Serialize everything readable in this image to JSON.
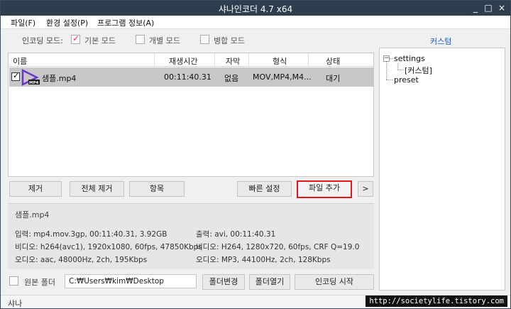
{
  "window": {
    "title": "샤나인코더 4.7 x64",
    "minimize": "_",
    "maximize": "□",
    "close": "×"
  },
  "menu": {
    "file": "파일(F)",
    "settings": "환경 설정(P)",
    "about": "프로그램 정보(A)"
  },
  "mode": {
    "label": "인코딩 모드:",
    "basic": "기본 모드",
    "individual": "개별 모드",
    "merge": "병합 모드",
    "basic_checked": true,
    "custom_link": "커스텀"
  },
  "filelist": {
    "columns": [
      "이름",
      "재생시간",
      "자막",
      "형식",
      "상태"
    ],
    "rows": [
      {
        "name": "샘플.mp4",
        "duration": "00:11:40.31",
        "subtitle": "없음",
        "format": "MOV,MP4,M4...",
        "status": "대기",
        "checked": true
      }
    ]
  },
  "tree": {
    "root": "settings",
    "child": "[커스텀]",
    "preset": "preset",
    "expander": "−"
  },
  "buttons": {
    "remove": "제거",
    "remove_all": "전체 제거",
    "items": "항목",
    "quick_settings": "빠른 설정",
    "add_file": "파일 추가",
    "more": ">",
    "change_folder": "폴더변경",
    "open_folder": "폴더열기",
    "start_encoding": "인코딩 시작"
  },
  "info": {
    "filename": "샘플.mp4",
    "input_line": "입력: mp4.mov.3gp, 00:11:40.31, 3.92GB",
    "input_video": "비디오: h264(avc1), 1920x1080, 60fps, 47850Kbps",
    "input_audio": "오디오: aac, 48000Hz, 2ch, 195Kbps",
    "output_line": "출력: avi, 00:11:40.31",
    "output_video": "비디오: H264, 1280x720, 60fps, CRF Q=19.0",
    "output_audio": "오디오: MP3, 44100Hz, 2ch, 128Kbps"
  },
  "output": {
    "same_folder_label": "원본 폴더",
    "path": "C:₩Users₩kim₩Desktop"
  },
  "status": {
    "text": "샤나",
    "watermark": "http://societylife.tistory.com"
  },
  "colors": {
    "titlebar": "#2f3e4e",
    "row_selected": "#c8c8c8",
    "highlight": "#e01818",
    "link": "#1e5bb5",
    "play_icon": "#6b36c9"
  }
}
